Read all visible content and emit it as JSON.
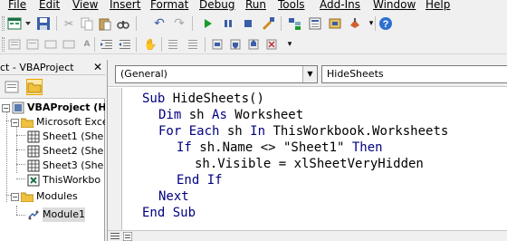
{
  "menu": {
    "items": [
      {
        "label": "File"
      },
      {
        "label": "Edit"
      },
      {
        "label": "View"
      },
      {
        "label": "Insert"
      },
      {
        "label": "Format"
      },
      {
        "label": "Debug"
      },
      {
        "label": "Run"
      },
      {
        "label": "Tools"
      },
      {
        "label": "Add-Ins"
      },
      {
        "label": "Window"
      },
      {
        "label": "Help"
      }
    ]
  },
  "project": {
    "title": "ct - VBAProject",
    "close": "✕",
    "tree": {
      "root": "VBAProject (Hidin",
      "folder_objects": "Microsoft Excel O",
      "sheet1": "Sheet1 (She",
      "sheet2": "Sheet2 (She",
      "sheet3": "Sheet3 (She",
      "thisworkbook": "ThisWorkbo",
      "folder_modules": "Modules",
      "module1": "Module1"
    }
  },
  "code": {
    "object_combo": "(General)",
    "proc_combo": "HideSheets",
    "combo_arrow": "▼",
    "lines": [
      {
        "kw": "Sub",
        "rest": " HideSheets()"
      },
      {
        "kw": "Dim",
        "rest": " sh ",
        "kw2": "As",
        "rest2": " Worksheet"
      },
      {
        "kw": "For Each",
        "rest": " sh ",
        "kw2": "In",
        "rest2": " ThisWorkbook.Worksheets"
      },
      {
        "kw": "If",
        "rest": " sh.Name <> \"Sheet1\" ",
        "kw2": "Then",
        "rest2": ""
      },
      {
        "kw": "",
        "rest": "sh.Visible = xlSheetVeryHidden"
      },
      {
        "kw": "End If",
        "rest": ""
      },
      {
        "kw": "Next",
        "rest": ""
      },
      {
        "kw": "End Sub",
        "rest": ""
      }
    ]
  },
  "colors": {
    "keyword": "#00007f",
    "selection_highlight": "#ffe8a6"
  }
}
